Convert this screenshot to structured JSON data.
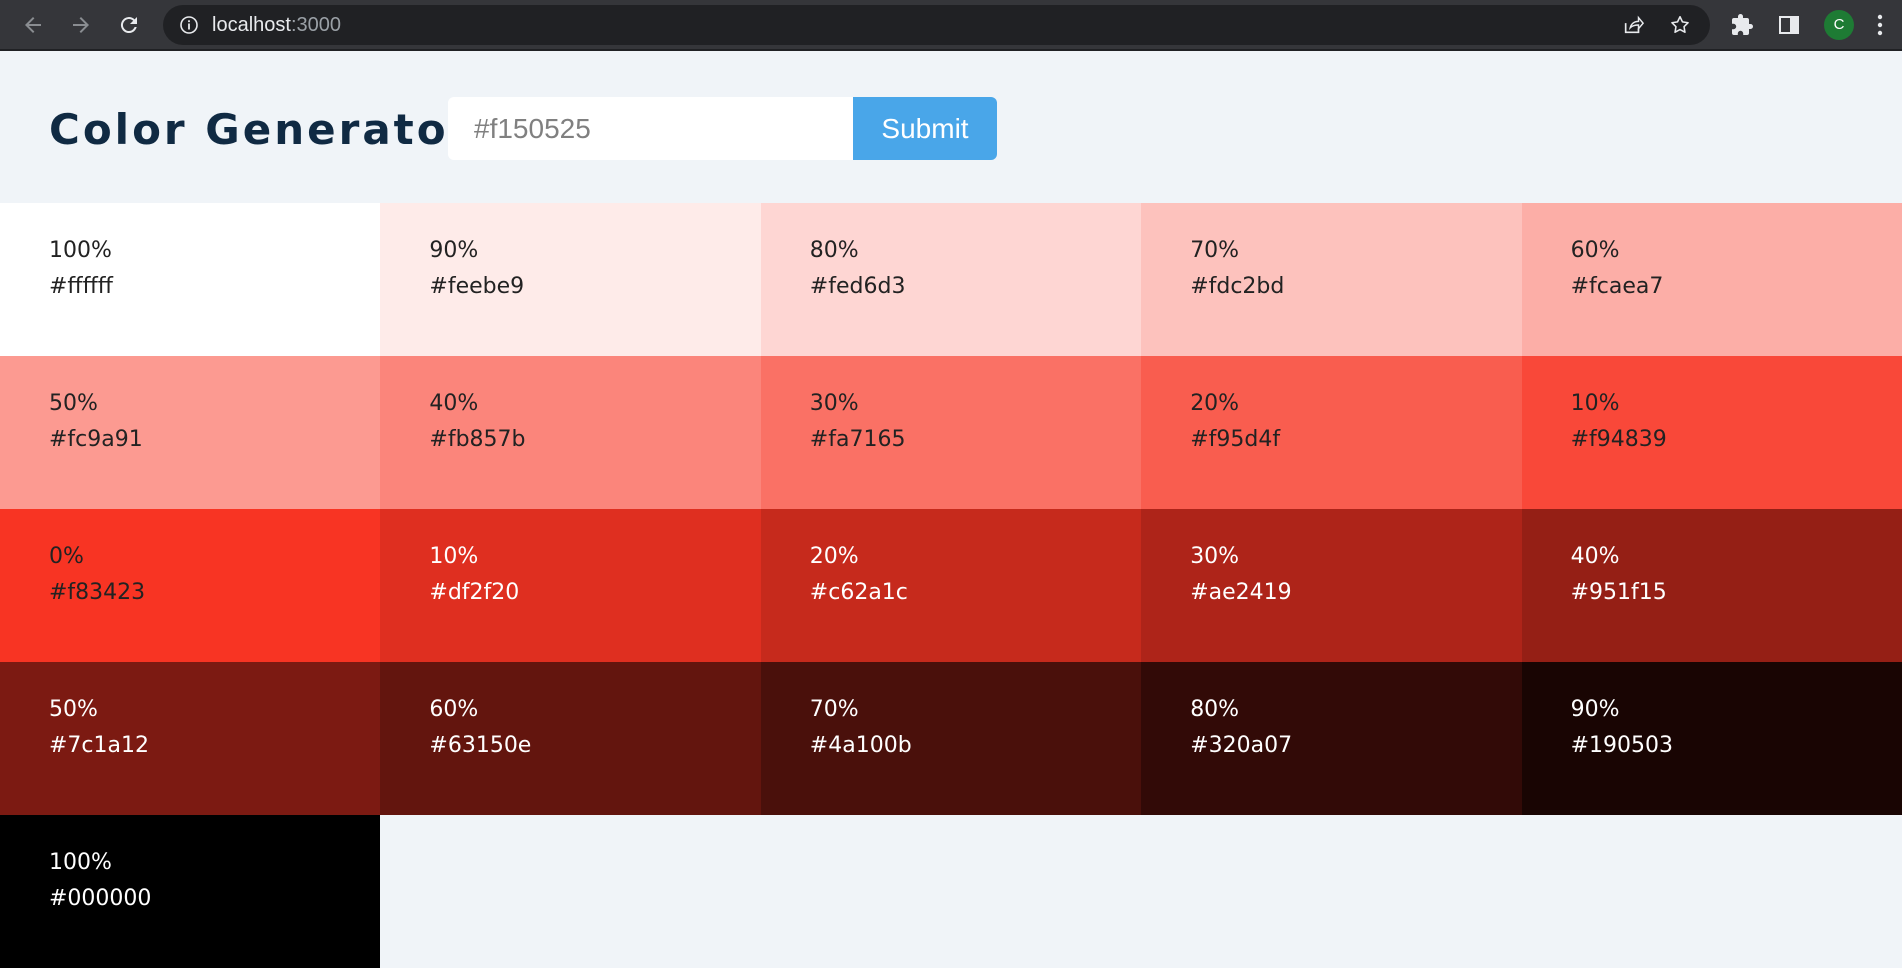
{
  "browser": {
    "url_host": "localhost",
    "url_port": ":3000",
    "profile_initial": "C"
  },
  "header": {
    "title": "Color Generator",
    "input_value": "",
    "input_placeholder": "#f150525",
    "submit_label": "Submit"
  },
  "swatches": [
    {
      "percent": "100%",
      "hex": "#ffffff",
      "bg": "#ffffff",
      "text_color": "#222222"
    },
    {
      "percent": "90%",
      "hex": "#feebe9",
      "bg": "#feebe9",
      "text_color": "#222222"
    },
    {
      "percent": "80%",
      "hex": "#fed6d3",
      "bg": "#fed6d3",
      "text_color": "#222222"
    },
    {
      "percent": "70%",
      "hex": "#fdc2bd",
      "bg": "#fdc2bd",
      "text_color": "#222222"
    },
    {
      "percent": "60%",
      "hex": "#fcaea7",
      "bg": "#fcaea7",
      "text_color": "#222222"
    },
    {
      "percent": "50%",
      "hex": "#fc9a91",
      "bg": "#fc9a91",
      "text_color": "#222222"
    },
    {
      "percent": "40%",
      "hex": "#fb857b",
      "bg": "#fb857b",
      "text_color": "#222222"
    },
    {
      "percent": "30%",
      "hex": "#fa7165",
      "bg": "#fa7165",
      "text_color": "#222222"
    },
    {
      "percent": "20%",
      "hex": "#f95d4f",
      "bg": "#f95d4f",
      "text_color": "#222222"
    },
    {
      "percent": "10%",
      "hex": "#f94839",
      "bg": "#f94839",
      "text_color": "#222222"
    },
    {
      "percent": "0%",
      "hex": "#f83423",
      "bg": "#f83423",
      "text_color": "#222222"
    },
    {
      "percent": "10%",
      "hex": "#df2f20",
      "bg": "#df2f20",
      "text_color": "#ffffff"
    },
    {
      "percent": "20%",
      "hex": "#c62a1c",
      "bg": "#c62a1c",
      "text_color": "#ffffff"
    },
    {
      "percent": "30%",
      "hex": "#ae2419",
      "bg": "#ae2419",
      "text_color": "#ffffff"
    },
    {
      "percent": "40%",
      "hex": "#951f15",
      "bg": "#951f15",
      "text_color": "#ffffff"
    },
    {
      "percent": "50%",
      "hex": "#7c1a12",
      "bg": "#7c1a12",
      "text_color": "#ffffff"
    },
    {
      "percent": "60%",
      "hex": "#63150e",
      "bg": "#63150e",
      "text_color": "#ffffff"
    },
    {
      "percent": "70%",
      "hex": "#4a100b",
      "bg": "#4a100b",
      "text_color": "#ffffff"
    },
    {
      "percent": "80%",
      "hex": "#320a07",
      "bg": "#320a07",
      "text_color": "#ffffff"
    },
    {
      "percent": "90%",
      "hex": "#190503",
      "bg": "#190503",
      "text_color": "#ffffff"
    },
    {
      "percent": "100%",
      "hex": "#000000",
      "bg": "#000000",
      "text_color": "#ffffff"
    }
  ]
}
